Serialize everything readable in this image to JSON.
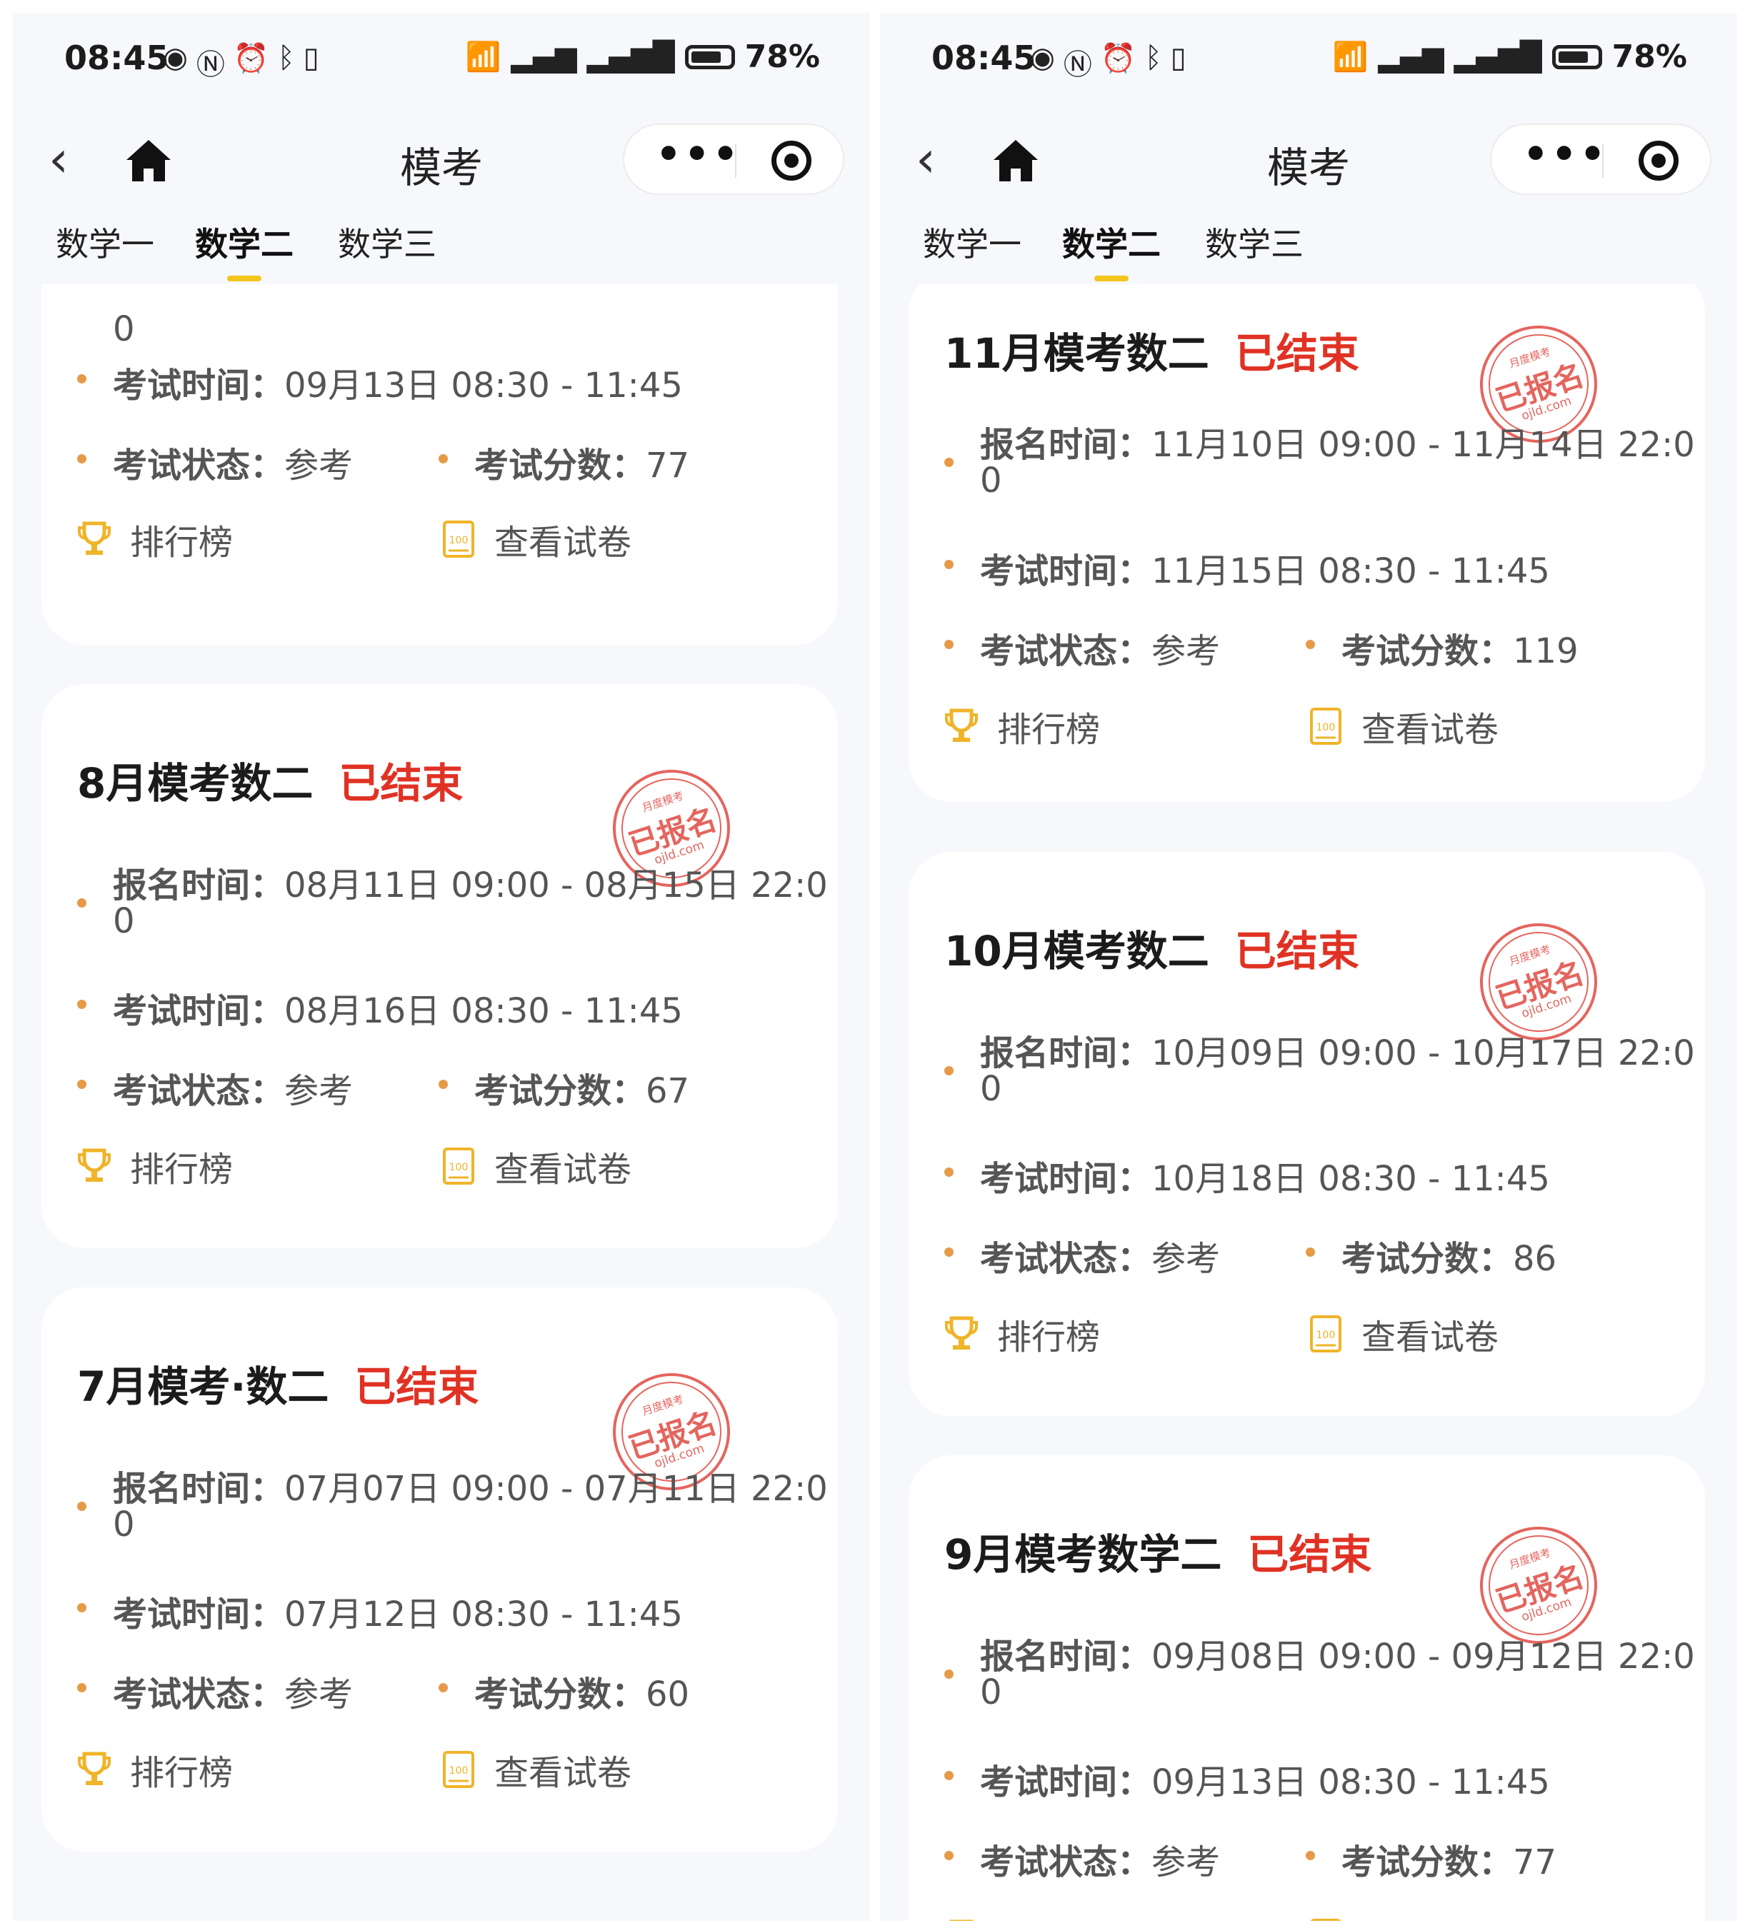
{
  "status_bar": {
    "time": "08:45",
    "battery_text": "78%",
    "battery_level": 0.78,
    "left_icons": [
      "eye-icon",
      "nfc-icon",
      "alarm-icon",
      "bluetooth-icon",
      "vibrate-icon"
    ],
    "right_icons": [
      "wifi-icon",
      "signal-icon",
      "4g-signal-icon",
      "battery-icon"
    ]
  },
  "nav": {
    "title": "模考"
  },
  "tabs": [
    "数学一",
    "数学二",
    "数学三"
  ],
  "active_tab": "数学二",
  "labels": {
    "signup": "报名时间：",
    "exam_time": "考试时间：",
    "status": "考试状态：",
    "score": "考试分数：",
    "ranking": "排行榜",
    "view_paper": "查看试卷",
    "ended": "已结束"
  },
  "stamp": {
    "top": "月度模考",
    "main": "已报名",
    "bottom": "ojld.com"
  },
  "left_panel": {
    "partial_top": {
      "signup_line2": "0",
      "exam_time": "09月13日 08:30 - 11:45",
      "status": "参考",
      "score": "77"
    },
    "cards": [
      {
        "title": "8月模考数二",
        "signup_line1": "08月11日 09:00 - 08月15日 22:0",
        "signup_line2": "0",
        "exam_time": "08月16日 08:30 - 11:45",
        "status": "参考",
        "score": "67"
      },
      {
        "title": "7月模考·数二",
        "signup_line1": "07月07日 09:00 - 07月11日 22:0",
        "signup_line2": "0",
        "exam_time": "07月12日 08:30 - 11:45",
        "status": "参考",
        "score": "60"
      }
    ]
  },
  "right_panel": {
    "cards": [
      {
        "title": "11月模考数二",
        "signup_line1": "11月10日 09:00 - 11月14日 22:0",
        "signup_line2": "0",
        "exam_time": "11月15日 08:30 - 11:45",
        "status": "参考",
        "score": "119"
      },
      {
        "title": "10月模考数二",
        "signup_line1": "10月09日 09:00 - 10月17日 22:0",
        "signup_line2": "0",
        "exam_time": "10月18日 08:30 - 11:45",
        "status": "参考",
        "score": "86"
      },
      {
        "title": "9月模考数学二",
        "signup_line1": "09月08日 09:00 - 09月12日 22:0",
        "signup_line2": "0",
        "exam_time": "09月13日 08:30 - 11:45",
        "status": "参考",
        "score": "77"
      }
    ]
  }
}
